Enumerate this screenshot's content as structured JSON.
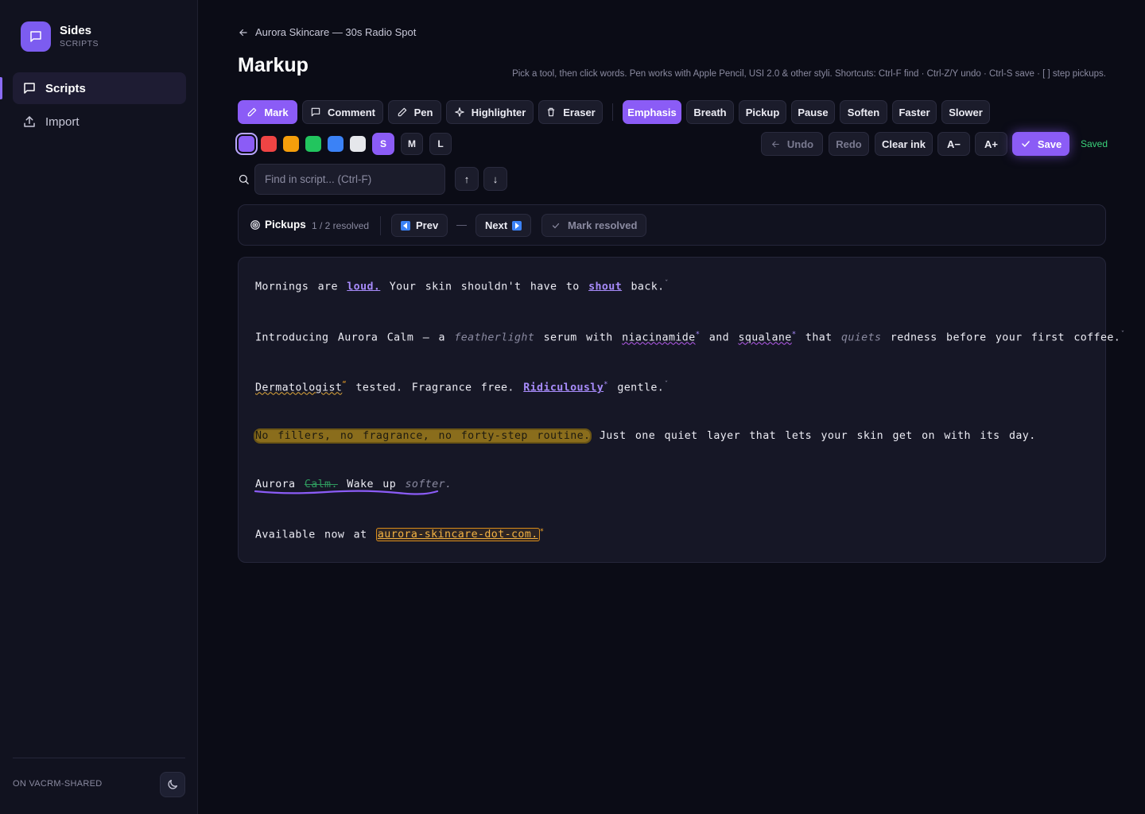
{
  "brand": {
    "name": "Sides",
    "subtitle": "SCRIPTS"
  },
  "sidebar": {
    "items": [
      {
        "label": "Scripts",
        "icon": "message-square-icon",
        "active": true
      },
      {
        "label": "Import",
        "icon": "upload-icon",
        "active": false
      }
    ],
    "footer_label": "ON VACRM-SHARED",
    "theme_icon": "moon-icon"
  },
  "breadcrumb": {
    "label": "Aurora Skincare — 30s Radio Spot"
  },
  "page": {
    "title": "Markup",
    "hint": "Pick a tool, then click words. Pen works with Apple Pencil, USI 2.0 & other styli. Shortcuts: Ctrl-F find · Ctrl-Z/Y undo · Ctrl-S save · [ ] step pickups."
  },
  "tools": {
    "mark": "Mark",
    "comment": "Comment",
    "pen": "Pen",
    "highlighter": "Highlighter",
    "eraser": "Eraser"
  },
  "directions": {
    "emphasis": "Emphasis",
    "breath": "Breath",
    "pickup": "Pickup",
    "pause": "Pause",
    "soften": "Soften",
    "faster": "Faster",
    "slower": "Slower"
  },
  "colors": {
    "accent": "#8b5cf6",
    "swatches": [
      "#8b5cf6",
      "#ef4444",
      "#f59e0b",
      "#22c55e",
      "#3b82f6",
      "#e5e7eb"
    ]
  },
  "sizes": {
    "s": "S",
    "m": "M",
    "l": "L"
  },
  "actions": {
    "undo": "Undo",
    "redo": "Redo",
    "clear_ink": "Clear ink",
    "font_down": "A−",
    "font_up": "A+",
    "save": "Save",
    "status": "Saved"
  },
  "search": {
    "placeholder": "Find in script... (Ctrl-F)",
    "up": "↑",
    "down": "↓"
  },
  "pickups": {
    "title": "Pickups",
    "count": "1 / 2 resolved",
    "prev": "Prev",
    "dash": "—",
    "next": "Next",
    "mark_resolved": "Mark resolved"
  },
  "script": {
    "l1": {
      "a": "Mornings are ",
      "loud": "loud.",
      "b": " Your skin shouldn't have to ",
      "shout": "shout",
      "c": " back."
    },
    "l2": {
      "a": "Introducing Aurora Calm — a ",
      "featherlight": "featherlight",
      "b": " serum with ",
      "niacinamide": "niacinamide",
      "c": " and ",
      "squalane": "squalane",
      "d": " that ",
      "quiets": "quiets",
      "e": " redness before your first coffee."
    },
    "l3": {
      "dermatologist": "Dermatologist",
      "a": " tested. Fragrance free. ",
      "ridiculously": "Ridiculously",
      "b": " gentle."
    },
    "l4": {
      "highlight": "No fillers, no fragrance, no forty-step routine.",
      "a": " Just one quiet layer that lets your skin get on with its day."
    },
    "l5": {
      "a": "Aurora ",
      "calm": "Calm.",
      "b": " Wake up ",
      "softer": "softer."
    },
    "l6": {
      "a": "Available now at ",
      "url": "aurora-skincare-dot-com."
    }
  }
}
